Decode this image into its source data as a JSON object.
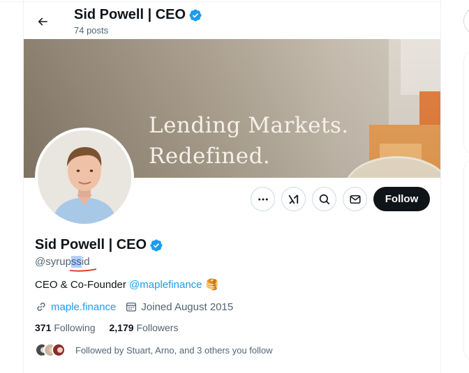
{
  "header": {
    "title": "Sid Powell | CEO",
    "posts_count": "74 posts"
  },
  "banner": {
    "line1": "Lending Markets.",
    "line2": "Redefined."
  },
  "actions": {
    "follow_label": "Follow"
  },
  "profile": {
    "name": "Sid Powell | CEO",
    "handle_prefix": "@syrup",
    "handle_selected": "ss",
    "handle_suffix": "id",
    "bio_text": "CEO & Co-Founder ",
    "bio_link": "@maplefinance",
    "bio_emoji": "🥞",
    "website": "maple.finance",
    "joined": "Joined August 2015",
    "following_count": "371",
    "following_label": "Following",
    "followers_count": "2,179",
    "followers_label": "Followers",
    "followed_by": "Followed by Stuart, Arno, and 3 others you follow"
  },
  "colors": {
    "accent": "#1d9bf0",
    "text": "#0f1419",
    "muted": "#536471",
    "follow_bg": "#0f1419"
  },
  "icons": [
    "back-arrow-icon",
    "verified-badge-icon",
    "more-icon",
    "grok-icon",
    "search-icon",
    "message-icon",
    "link-icon",
    "calendar-icon"
  ]
}
